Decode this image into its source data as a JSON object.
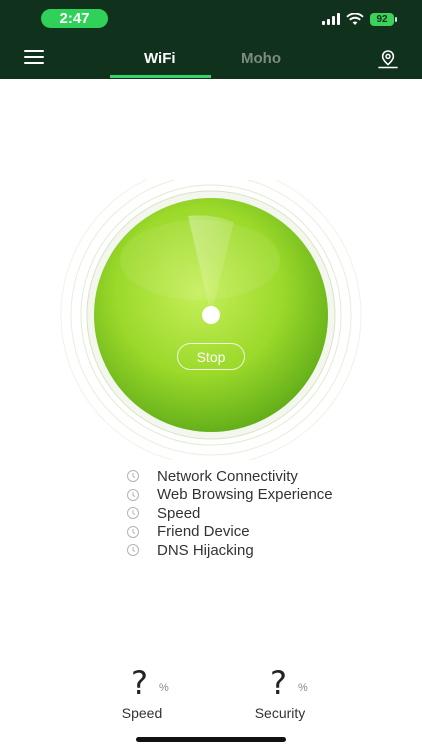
{
  "status_bar": {
    "time": "2:47",
    "battery": "92"
  },
  "header": {
    "tabs": [
      {
        "label": "WiFi",
        "active": true
      },
      {
        "label": "Moho",
        "active": false
      }
    ]
  },
  "scan": {
    "stop_label": "Stop"
  },
  "checks": [
    {
      "label": "Network Connectivity"
    },
    {
      "label": "Web Browsing Experience"
    },
    {
      "label": "Speed"
    },
    {
      "label": "Friend Device"
    },
    {
      "label": "DNS Hijacking"
    }
  ],
  "stats": {
    "speed": {
      "value": "?",
      "unit": "%",
      "label": "Speed"
    },
    "security": {
      "value": "?",
      "unit": "%",
      "label": "Security"
    }
  },
  "colors": {
    "header_bg": "#10311b",
    "accent": "#39d36a",
    "radar_green": "#8fd12a"
  },
  "icons": [
    "menu-icon",
    "location-icon",
    "clock-icon",
    "signal-icon",
    "wifi-icon",
    "battery-icon"
  ]
}
